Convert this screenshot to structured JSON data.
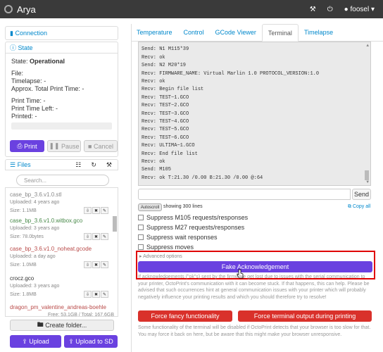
{
  "nav": {
    "title": "Arya",
    "user": "foosel"
  },
  "connection": {
    "label": "Connection"
  },
  "state": {
    "label": "State",
    "state_prefix": "State:",
    "state_value": "Operational",
    "file": "File:",
    "timelapse_label": "Timelapse:",
    "timelapse_value": "-",
    "total_label": "Approx. Total Print Time:",
    "total_value": "-",
    "print_time_label": "Print Time:",
    "print_time_value": "-",
    "left_label": "Print Time Left:",
    "left_value": "-",
    "printed_label": "Printed:",
    "printed_value": "-",
    "print_btn": "Print",
    "pause_btn": "Pause",
    "cancel_btn": "Cancel"
  },
  "files": {
    "label": "Files",
    "search_placeholder": "Search...",
    "items": [
      {
        "name": "case_bp_3.6.v1.0.stl",
        "uploaded": "Uploaded: 4 years ago",
        "size": "Size: 1.1MB",
        "color": "#888"
      },
      {
        "name": "case_bp_3.6.v1.0.witbox.gco",
        "uploaded": "Uploaded: 3 years ago",
        "size": "Size: 78.0bytes",
        "color": "#468847"
      },
      {
        "name": "case_bp_3.6.v1.0_noheat.gcode",
        "uploaded": "Uploaded: a day ago",
        "size": "Size: 1.0MB",
        "color": "#b94a48"
      },
      {
        "name": "crocz.gco",
        "uploaded": "Uploaded: 3 years ago",
        "size": "Size: 1.8MB",
        "color": "#333"
      },
      {
        "name": "dragon_pm_valentine_andreas-boehle",
        "uploaded": "",
        "size": "",
        "color": "#b94a48"
      }
    ],
    "storage": "Free: 53.1GB / Total: 167.6GB",
    "create_folder": "Create folder...",
    "upload": "Upload",
    "upload_sd": "Upload to SD"
  },
  "tabs": [
    "Temperature",
    "Control",
    "GCode Viewer",
    "Terminal",
    "Timelapse"
  ],
  "terminal": {
    "lines": [
      "Send: N0 M110 N0*125",
      "Send: N1 M115*39",
      "Recv: ok",
      "Send: N2 M20*19",
      "Recv: FIRMWARE_NAME: Virtual Marlin 1.0 PROTOCOL_VERSION:1.0",
      "Recv: ok",
      "Recv: Begin file list",
      "Recv: TEST~1.GCO",
      "Recv: TEST~2.GCO",
      "Recv: TEST~3.GCO",
      "Recv: TEST~4.GCO",
      "Recv: TEST~5.GCO",
      "Recv: TEST~6.GCO",
      "Recv: ULTIMA~1.GCO",
      "Recv: End file list",
      "Recv: ok",
      "Send: M105",
      "Recv: ok T:21.30 /0.00 B:21.30 /0.00 @:64"
    ],
    "send": "Send",
    "autoscroll": "Autoscroll",
    "showing": "showing 300 lines",
    "copy_all": "Copy all"
  },
  "suppress": [
    "Suppress M105 requests/responses",
    "Suppress M27 requests/responses",
    "Suppress wait responses",
    "Suppress moves"
  ],
  "advanced": {
    "toggle": "Advanced options",
    "fake_ack": "Fake Acknowledgement",
    "help": "If acknowledgements (\"ok\"s) sent by the firmware get lost due to issues with the serial communication to your printer, OctoPrint's communication with it can become stuck. If that happens, this can help. Please be advised that such occurrences hint at general communication issues with your printer which will probably negatively influence your printing results and which you should therefore try to resolve!",
    "force_fancy": "Force fancy functionality",
    "force_output": "Force terminal output during printing",
    "footer": "Some functionality of the terminal will be disabled if OctoPrint detects that your browser is too slow for that. You may force it back on here, but be aware that this might make your browser unresponsive."
  },
  "colors": {
    "accent": "#08c",
    "primary": "#6a41e0",
    "danger": "#d9312b",
    "highlight": "#e00000"
  }
}
